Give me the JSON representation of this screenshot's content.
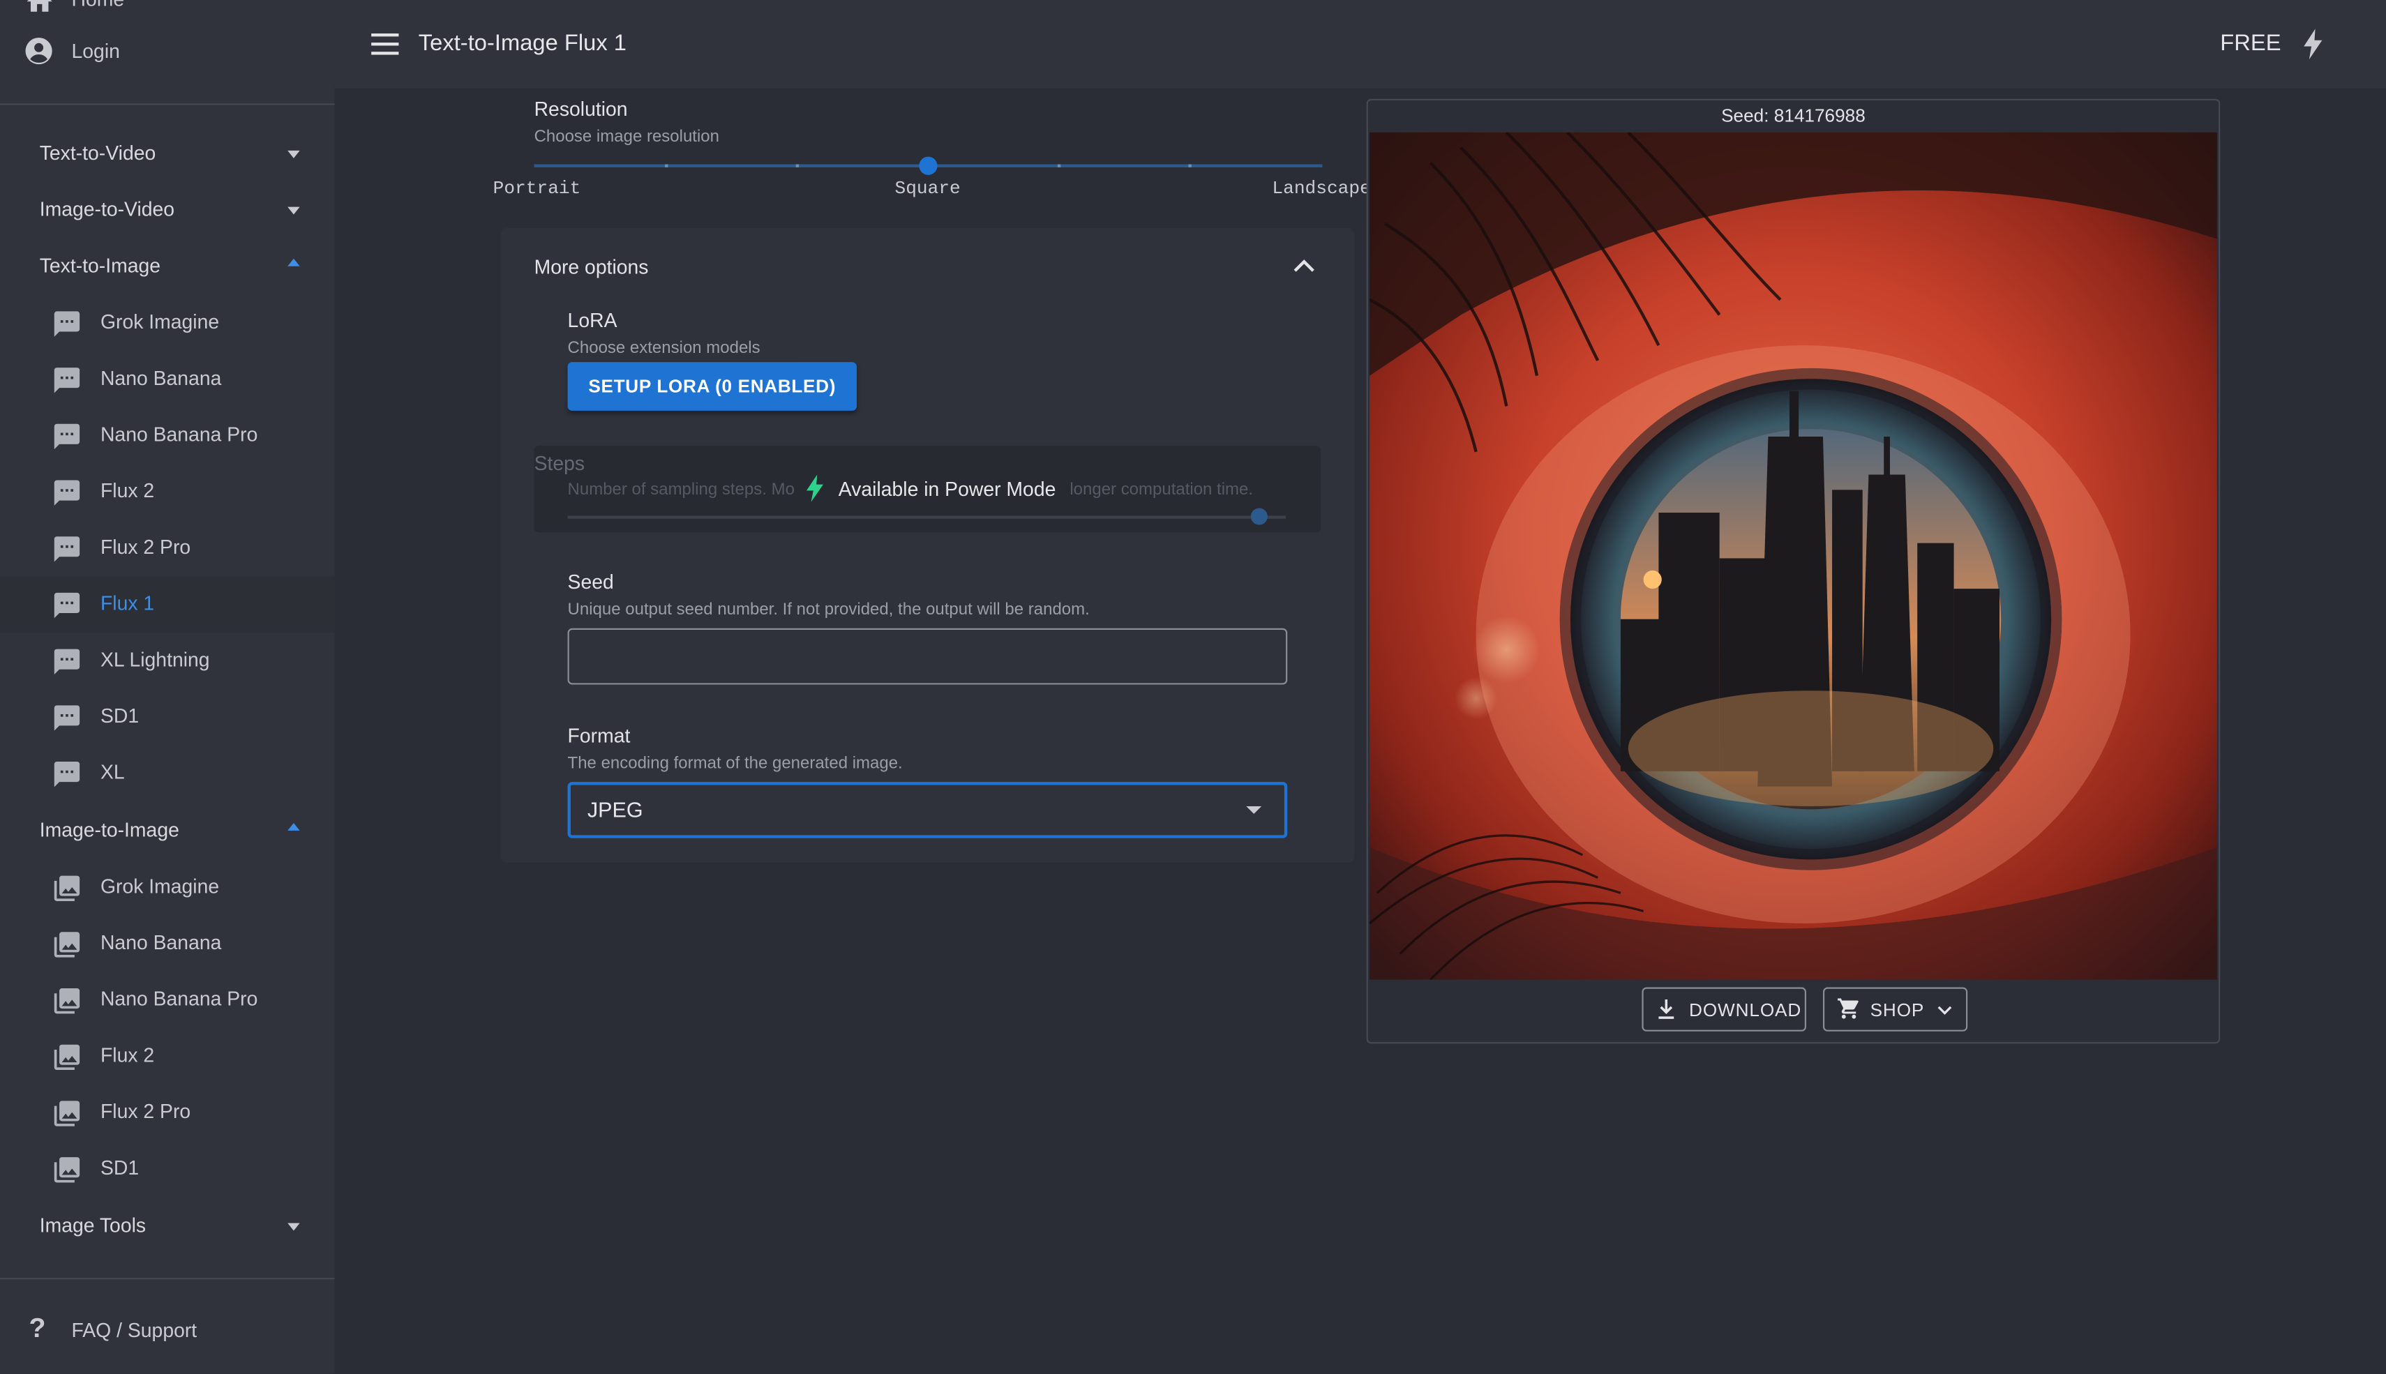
{
  "appbar": {
    "title": "Text-to-Image Flux 1",
    "plan": "FREE"
  },
  "sidebar": {
    "top_items": [
      {
        "label": "Home",
        "icon": "home-icon"
      },
      {
        "label": "Login",
        "icon": "account-circle-icon"
      }
    ],
    "sections": [
      {
        "label": "Text-to-Video",
        "expanded": false,
        "items": []
      },
      {
        "label": "Image-to-Video",
        "expanded": false,
        "items": []
      },
      {
        "label": "Text-to-Image",
        "expanded": true,
        "items": [
          {
            "label": "Grok Imagine",
            "icon": "chat-icon"
          },
          {
            "label": "Nano Banana",
            "icon": "chat-icon"
          },
          {
            "label": "Nano Banana Pro",
            "icon": "chat-icon"
          },
          {
            "label": "Flux 2",
            "icon": "chat-icon"
          },
          {
            "label": "Flux 2 Pro",
            "icon": "chat-icon"
          },
          {
            "label": "Flux 1",
            "icon": "chat-icon",
            "selected": true
          },
          {
            "label": "XL Lightning",
            "icon": "chat-icon"
          },
          {
            "label": "SD1",
            "icon": "chat-icon"
          },
          {
            "label": "XL",
            "icon": "chat-icon"
          }
        ]
      },
      {
        "label": "Image-to-Image",
        "expanded": true,
        "items": [
          {
            "label": "Grok Imagine",
            "icon": "image-icon"
          },
          {
            "label": "Nano Banana",
            "icon": "image-icon"
          },
          {
            "label": "Nano Banana Pro",
            "icon": "image-icon"
          },
          {
            "label": "Flux 2",
            "icon": "image-icon"
          },
          {
            "label": "Flux 2 Pro",
            "icon": "image-icon"
          },
          {
            "label": "SD1",
            "icon": "image-icon"
          }
        ]
      },
      {
        "label": "Image Tools",
        "expanded": false,
        "items": []
      }
    ],
    "footer": {
      "label": "FAQ / Support",
      "icon": "question-mark-icon"
    }
  },
  "resolution": {
    "label": "Resolution",
    "help": "Choose image resolution",
    "marks": [
      "Portrait",
      "Square",
      "Landscape"
    ],
    "value_fraction": 0.5
  },
  "more_options": {
    "title": "More options",
    "lora": {
      "label": "LoRA",
      "help": "Choose extension models",
      "button": "SETUP LORA (0 ENABLED)"
    },
    "steps": {
      "label": "Steps",
      "help_left": "Number of sampling steps. Mo",
      "help_right": "longer computation time.",
      "overlay": "Available in Power Mode",
      "value_fraction": 0.95
    },
    "seed": {
      "label": "Seed",
      "help": "Unique output seed number. If not provided, the output will be random.",
      "value": ""
    },
    "format": {
      "label": "Format",
      "help": "The encoding format of the generated image.",
      "selected": "JPEG"
    }
  },
  "preview": {
    "seed_text": "Seed: 814176988",
    "download_label": "DOWNLOAD",
    "shop_label": "SHOP"
  },
  "colors": {
    "accent": "#1f73d2",
    "selected_text": "#3d8ee6",
    "power_green": "#2bd48a",
    "background": "#2a2d36",
    "sidebar": "#30333b"
  }
}
